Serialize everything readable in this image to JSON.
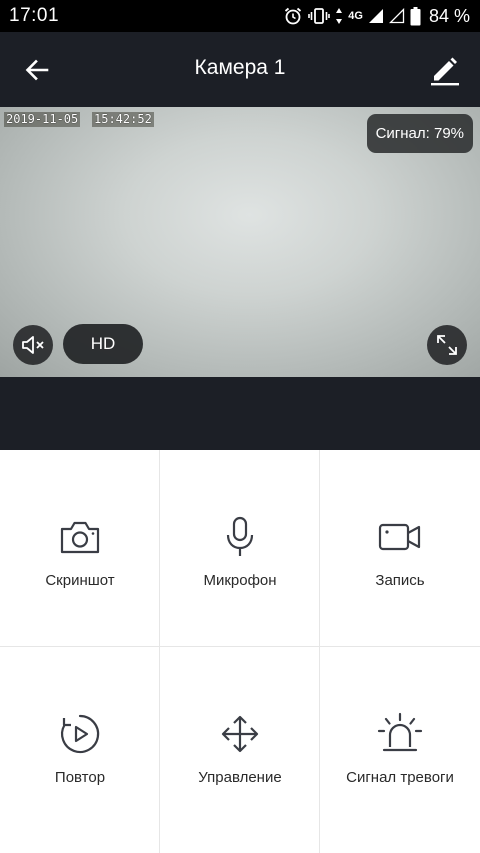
{
  "status_bar": {
    "time": "17:01",
    "network": "4G",
    "battery": "84 %"
  },
  "header": {
    "title": "Камера 1",
    "back_icon": "arrow-left-icon",
    "edit_icon": "pencil-icon"
  },
  "video": {
    "date": "2019-11-05",
    "time": "15:42:52",
    "signal": "Сигнал: 79%",
    "quality": "HD",
    "mute_icon": "speaker-muted-icon",
    "fullscreen_icon": "fullscreen-icon"
  },
  "actions": [
    {
      "label": "Скриншот",
      "icon": "camera-icon"
    },
    {
      "label": "Микрофон",
      "icon": "microphone-icon"
    },
    {
      "label": "Запись",
      "icon": "video-camera-icon"
    },
    {
      "label": "Повтор",
      "icon": "playback-icon"
    },
    {
      "label": "Управление",
      "icon": "move-arrows-icon"
    },
    {
      "label": "Сигнал тревоги",
      "icon": "alarm-siren-icon"
    }
  ],
  "colors": {
    "header_bg": "#1c1f26",
    "status_bg": "#000000",
    "icon_stroke": "#3a3d45"
  }
}
